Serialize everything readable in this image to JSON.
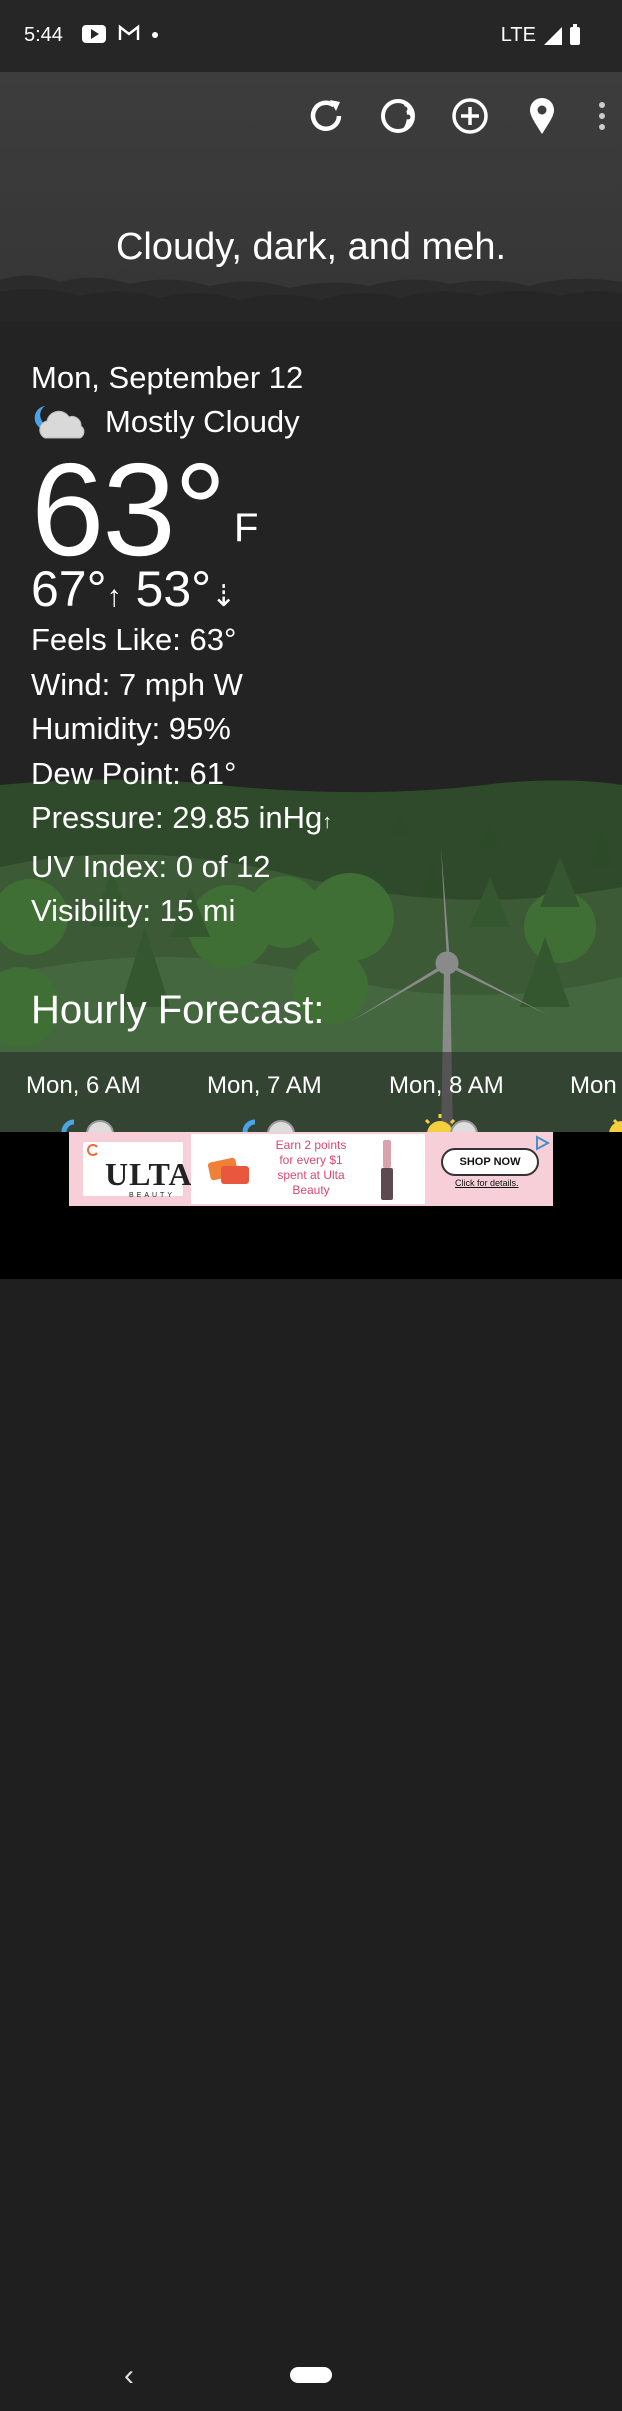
{
  "status_bar": {
    "time": "5:44",
    "network": "LTE",
    "icons": [
      "youtube-icon",
      "gmail-icon",
      "notification-dot-icon",
      "signal-icon",
      "battery-icon"
    ]
  },
  "toolbar": {
    "actions": [
      "refresh-icon",
      "theme-icon",
      "add-location-icon",
      "location-pin-icon",
      "more-options-icon"
    ]
  },
  "tagline": "Cloudy, dark, and meh.",
  "current": {
    "date": "Mon, September 12",
    "condition": "Mostly Cloudy",
    "condition_icon": "partly-cloudy-night-icon",
    "temperature": "63°",
    "unit": "F",
    "high": "67°",
    "low": "53°",
    "feels_like": "Feels Like:  63°",
    "wind": "Wind:  7 mph W",
    "humidity": "Humidity:  95%",
    "dew_point": "Dew Point:  61°",
    "pressure": "Pressure:  29.85 inHg",
    "uv_index": "UV Index:  0 of 12",
    "visibility": "Visibility:  15 mi"
  },
  "hourly": {
    "title": "Hourly Forecast:",
    "hours": [
      "Mon, 6 AM",
      "Mon, 7 AM",
      "Mon, 8 AM",
      "Mon"
    ]
  },
  "ad": {
    "brand": "ULTA",
    "brand_sub": "BEAUTY",
    "copy": "Earn 2 points for every $1 spent at Ulta Beauty",
    "cta": "SHOP NOW",
    "fine_print": "Click for details."
  },
  "colors": {
    "sky": "#3d3d3d",
    "background": "#232323",
    "grass": "#3c5a36",
    "tree": "#3f6f34",
    "ad_pink": "#f6cfd9"
  }
}
